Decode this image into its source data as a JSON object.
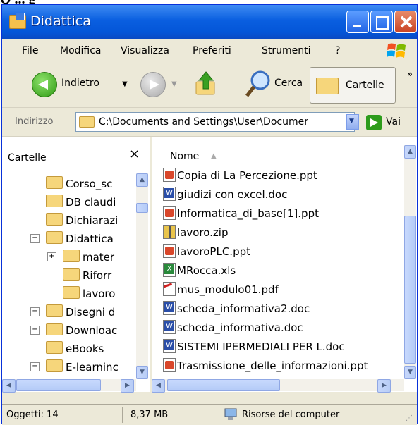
{
  "top_caption": "Q ... g",
  "window": {
    "title": "Didattica",
    "title_icon": "folder-icon"
  },
  "menu": [
    "File",
    "Modifica",
    "Visualizza",
    "Preferiti",
    "Strumenti",
    "?"
  ],
  "toolbar": {
    "back_label": "Indietro",
    "search_label": "Cerca",
    "folders_label": "Cartelle",
    "more_label": "»"
  },
  "address": {
    "label": "Indirizzo",
    "value": "C:\\Documents and Settings\\User\\Documer",
    "go_label": "Vai"
  },
  "left_pane": {
    "title": "Cartelle",
    "close_label": "×",
    "items": [
      {
        "label": "Corso_sc",
        "indent": 2,
        "expander": ""
      },
      {
        "label": "DB claudi",
        "indent": 2,
        "expander": ""
      },
      {
        "label": "Dichiarazi",
        "indent": 2,
        "expander": ""
      },
      {
        "label": "Didattica",
        "indent": 2,
        "expander": "−"
      },
      {
        "label": "mater",
        "indent": 3,
        "expander": "+"
      },
      {
        "label": "Riforr",
        "indent": 3,
        "expander": ""
      },
      {
        "label": "lavoro",
        "indent": 3,
        "expander": ""
      },
      {
        "label": "Disegni d",
        "indent": 2,
        "expander": "+"
      },
      {
        "label": "Downloac",
        "indent": 2,
        "expander": "+"
      },
      {
        "label": "eBooks",
        "indent": 2,
        "expander": ""
      },
      {
        "label": "E-learninc",
        "indent": 2,
        "expander": "+"
      }
    ]
  },
  "right_pane": {
    "column_header": "Nome",
    "sort_indicator": "▲",
    "files": [
      {
        "name": "Copia di La Percezione.ppt",
        "type": "ppt"
      },
      {
        "name": "giudizi con excel.doc",
        "type": "doc"
      },
      {
        "name": "Informatica_di_base[1].ppt",
        "type": "ppt"
      },
      {
        "name": "lavoro.zip",
        "type": "zip"
      },
      {
        "name": "lavoroPLC.ppt",
        "type": "ppt"
      },
      {
        "name": "MRocca.xls",
        "type": "xls"
      },
      {
        "name": "mus_modulo01.pdf",
        "type": "pdf"
      },
      {
        "name": "scheda_informativa2.doc",
        "type": "doc"
      },
      {
        "name": "scheda_informativa.doc",
        "type": "doc"
      },
      {
        "name": "SISTEMI IPERMEDIALI PER L.doc",
        "type": "doc"
      },
      {
        "name": "Trasmissione_delle_informazioni.ppt",
        "type": "ppt"
      }
    ]
  },
  "status": {
    "objects": "Oggetti: 14",
    "size": "8,37 MB",
    "location": "Risorse del computer"
  },
  "colors": {
    "titlebar": "#0a5fe0",
    "window_bg": "#ece9d8",
    "close_button": "#c94324"
  }
}
